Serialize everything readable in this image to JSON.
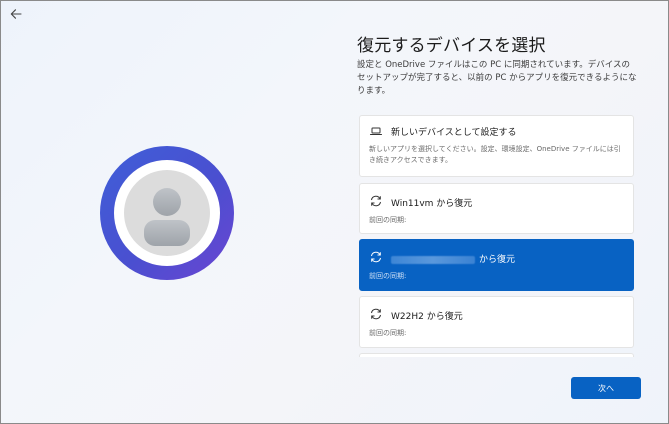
{
  "title": "復元するデバイスを選択",
  "description": "設定と OneDrive ファイルはこの PC に同期されています。デバイスのセットアップが完了すると、以前の PC からアプリを復元できるようになります。",
  "options": [
    {
      "icon": "laptop-icon",
      "title": "新しいデバイスとして設定する",
      "body": "新しいアプリを選択してください。設定、環境設定、OneDrive ファイルには引き続きアクセスできます。",
      "selected": false
    },
    {
      "icon": "sync-icon",
      "title": "Win11vm から復元",
      "subtitle": "前回の同期:",
      "selected": false
    },
    {
      "icon": "sync-icon",
      "title": "から復元",
      "subtitle": "前回の同期:",
      "selected": true,
      "name_redacted": true
    },
    {
      "icon": "sync-icon",
      "title": "W22H2 から復元",
      "subtitle": "前回の同期:",
      "selected": false
    }
  ],
  "next_button": "次へ",
  "colors": {
    "accent": "#0862c3",
    "ring_start": "#3f5fd8",
    "ring_end": "#6b45d2"
  }
}
